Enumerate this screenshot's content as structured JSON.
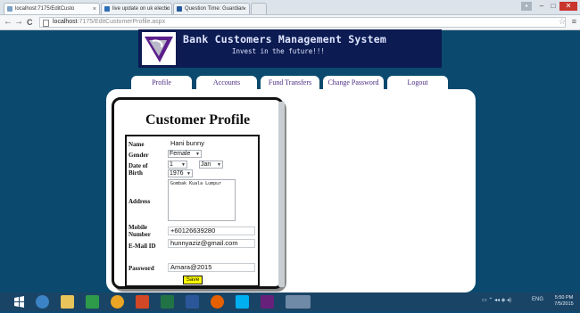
{
  "browser": {
    "tabs": [
      {
        "label": "localhost:7175/EditCusto"
      },
      {
        "label": "live update on uk electio"
      },
      {
        "label": "Question Time: Guardian"
      }
    ],
    "url_host": "localhost",
    "url_path": ":7175/EditCustomerProfile.aspx",
    "back": "←",
    "forward": "→",
    "reload": "C",
    "star": "☆",
    "menu": "≡",
    "tab_close": "×",
    "win_min": "–",
    "win_max": "□",
    "win_close": "✕",
    "user_btn": "▪"
  },
  "header": {
    "title": "Bank Customers Management System",
    "subtitle": "Invest in the future!!!"
  },
  "nav": [
    {
      "label": "Profile"
    },
    {
      "label": "Accounts"
    },
    {
      "label": "Fund Transfers"
    },
    {
      "label": "Change Password"
    },
    {
      "label": "Logout"
    }
  ],
  "profile": {
    "title": "Customer Profile",
    "labels": {
      "name": "Name",
      "gender": "Gender",
      "dob": "Date of Birth",
      "address": "Address",
      "mobile": "Mobile Number",
      "email": "E-Mail ID",
      "password": "Password"
    },
    "values": {
      "name": "Hani bunny",
      "gender": "Female",
      "dob_day": "1",
      "dob_month": "Jan",
      "dob_year": "1976",
      "address": "Gombak Kuala Lumpur",
      "mobile": "+60126639280",
      "email": "hunnyaziz@gmail.com",
      "password": "Amara@2015"
    },
    "save_label": "Save"
  },
  "taskbar": {
    "tray_lang": "ENG",
    "time": "5:50 PM",
    "date": "7/5/2015"
  }
}
